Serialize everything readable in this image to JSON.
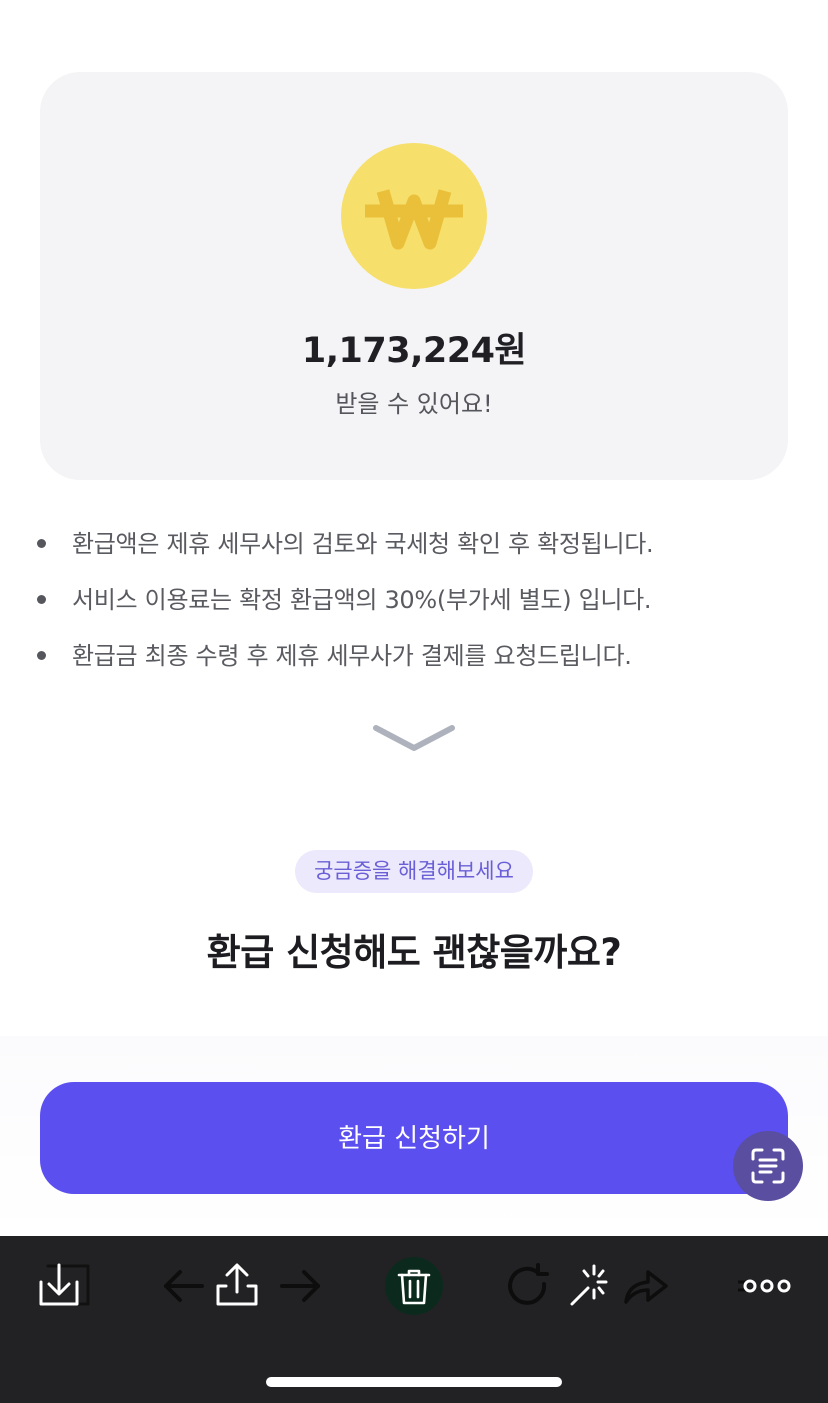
{
  "summary": {
    "amount": "1,173,224원",
    "subtitle": "받을 수 있어요!"
  },
  "notes": [
    "환급액은 제휴 세무사의 검토와 국세청 확인 후 확정됩니다.",
    "서비스 이용료는 확정 환급액의 30%(부가세 별도) 입니다.",
    "환급금 최종 수령 후 제휴 세무사가 결제를 요청드립니다."
  ],
  "faq": {
    "tag": "궁금증을 해결해보세요",
    "question": "환급 신청해도 괜찮을까요?"
  },
  "cta": {
    "label": "환급 신청하기"
  },
  "colors": {
    "accent": "#5b4ff0",
    "coin": "#f6df6b",
    "coin_symbol": "#eabf3a",
    "tag_bg": "#ebe9fb",
    "tag_text": "#6a5fd6"
  },
  "icons": {
    "coin": "won-coin-icon",
    "chevron": "chevron-down-icon",
    "scan": "text-scan-icon",
    "toolbar": [
      "download-icon",
      "back-arrow-icon",
      "share-icon",
      "forward-arrow-icon",
      "trash-icon",
      "rotate-icon",
      "magic-icon",
      "redo-icon",
      "more-icon"
    ]
  }
}
